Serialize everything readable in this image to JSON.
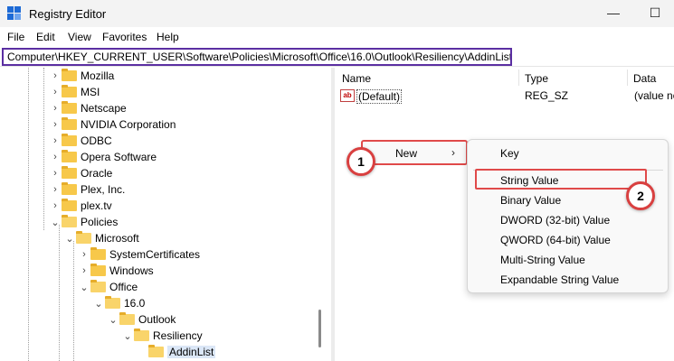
{
  "window": {
    "title": "Registry Editor",
    "minimize": "—",
    "maximize": "☐"
  },
  "menu": [
    "File",
    "Edit",
    "View",
    "Favorites",
    "Help"
  ],
  "address": "Computer\\HKEY_CURRENT_USER\\Software\\Policies\\Microsoft\\Office\\16.0\\Outlook\\Resiliency\\AddinList",
  "tree": [
    {
      "label": "Mozilla",
      "chevron": "›"
    },
    {
      "label": "MSI",
      "chevron": "›"
    },
    {
      "label": "Netscape",
      "chevron": "›"
    },
    {
      "label": "NVIDIA Corporation",
      "chevron": "›"
    },
    {
      "label": "ODBC",
      "chevron": "›"
    },
    {
      "label": "Opera Software",
      "chevron": "›"
    },
    {
      "label": "Oracle",
      "chevron": "›"
    },
    {
      "label": "Plex, Inc.",
      "chevron": "›"
    },
    {
      "label": "plex.tv",
      "chevron": "›"
    },
    {
      "label": "Policies",
      "chevron": "⌄"
    },
    {
      "label": "Microsoft",
      "chevron": "⌄"
    },
    {
      "label": "SystemCertificates",
      "chevron": "›"
    },
    {
      "label": "Windows",
      "chevron": "›"
    },
    {
      "label": "Office",
      "chevron": "⌄"
    },
    {
      "label": "16.0",
      "chevron": "⌄"
    },
    {
      "label": "Outlook",
      "chevron": "⌄"
    },
    {
      "label": "Resiliency",
      "chevron": "⌄"
    },
    {
      "label": "AddinList",
      "chevron": ""
    }
  ],
  "columns": {
    "name": "Name",
    "type": "Type",
    "data": "Data"
  },
  "values": [
    {
      "icon": "ab",
      "name": "(Default)",
      "type": "REG_SZ",
      "data": "(value not set)"
    }
  ],
  "context_menu": {
    "new_label": "New",
    "arrow": "›"
  },
  "submenu": {
    "key": "Key",
    "items": [
      "String Value",
      "Binary Value",
      "DWORD (32-bit) Value",
      "QWORD (64-bit) Value",
      "Multi-String Value",
      "Expandable String Value"
    ]
  },
  "badges": {
    "one": "1",
    "two": "2"
  },
  "colors": {
    "highlight_box": "#e04a4a",
    "address_box": "#5b2fa2",
    "selection": "#dbe7f7"
  }
}
